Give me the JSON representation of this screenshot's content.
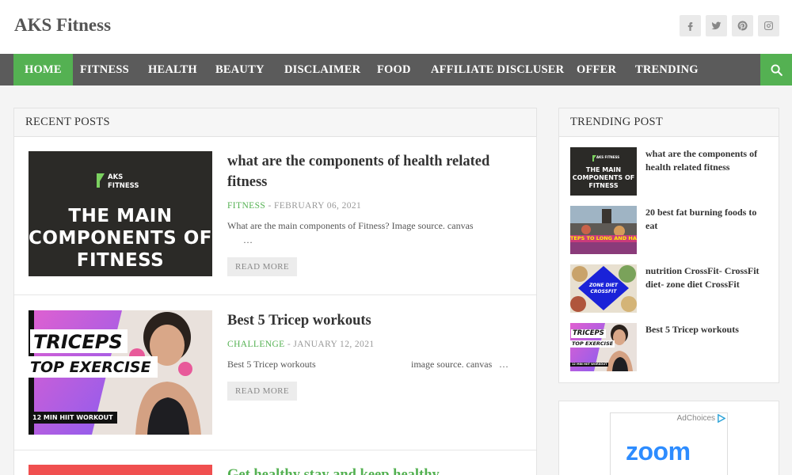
{
  "header": {
    "site_title": "AKS Fitness",
    "social": [
      "facebook-icon",
      "twitter-icon",
      "pinterest-icon",
      "instagram-icon"
    ]
  },
  "nav": {
    "items": [
      "HOME",
      "FITNESS",
      "HEALTH",
      "BEAUTY",
      "DISCLAIMER",
      "FOOD",
      "AFFILIATE DISCLUSER",
      "OFFER",
      "TRENDING"
    ],
    "active": "HOME"
  },
  "colors": {
    "accent": "#54b152",
    "nav_bg": "#5b5b5b"
  },
  "recent_posts": {
    "heading": "RECENT POSTS",
    "read_more_label": "READ MORE",
    "posts": [
      {
        "title": "what are the components of health related fitness",
        "category": "FITNESS",
        "date": "FEBRUARY 06, 2021",
        "excerpt": "What are the main components of Fitness? Image source. canvas",
        "ellipsis": "…",
        "thumb_brand": "AKS FITNESS",
        "thumb_headline": [
          "THE MAIN",
          "COMPONENTS OF",
          "FITNESS"
        ]
      },
      {
        "title": "Best 5 Tricep workouts",
        "category": "CHALLENGE",
        "date": "JANUARY 12, 2021",
        "excerpt_left": "Best 5  Tricep workouts",
        "excerpt_right": "image source. canvas",
        "ellipsis": "…",
        "thumb_line1": "TRICEPS",
        "thumb_line2": "TOP EXERCISE",
        "thumb_badge": "12 MIN HIIT WORKOUT"
      },
      {
        "title": "Get healthy stay and keep healthy"
      }
    ]
  },
  "trending": {
    "heading": "TRENDING POST",
    "items": [
      {
        "title": "what are the components of health related fitness",
        "thumb_brand": "AKS FITNESS",
        "thumb_headline": [
          "THE MAIN",
          "COMPONENTS OF",
          "FITNESS"
        ]
      },
      {
        "title": "20 best fat burning foods to eat",
        "thumb_caption": "TEPS TO LONG AND HAPPY LI"
      },
      {
        "title": "nutrition CrossFit- CrossFit diet- zone diet CrossFit",
        "thumb_caption_1": "ZONE DIET",
        "thumb_caption_2": "CROSSFIT"
      },
      {
        "title": "Best 5 Tricep workouts",
        "thumb_line1": "TRICEPS",
        "thumb_line2": "TOP EXERCISE",
        "thumb_badge": "12 MIN HIIT WORKOUT"
      }
    ]
  },
  "ad": {
    "adchoices": "AdChoices",
    "brand": "zoom"
  }
}
